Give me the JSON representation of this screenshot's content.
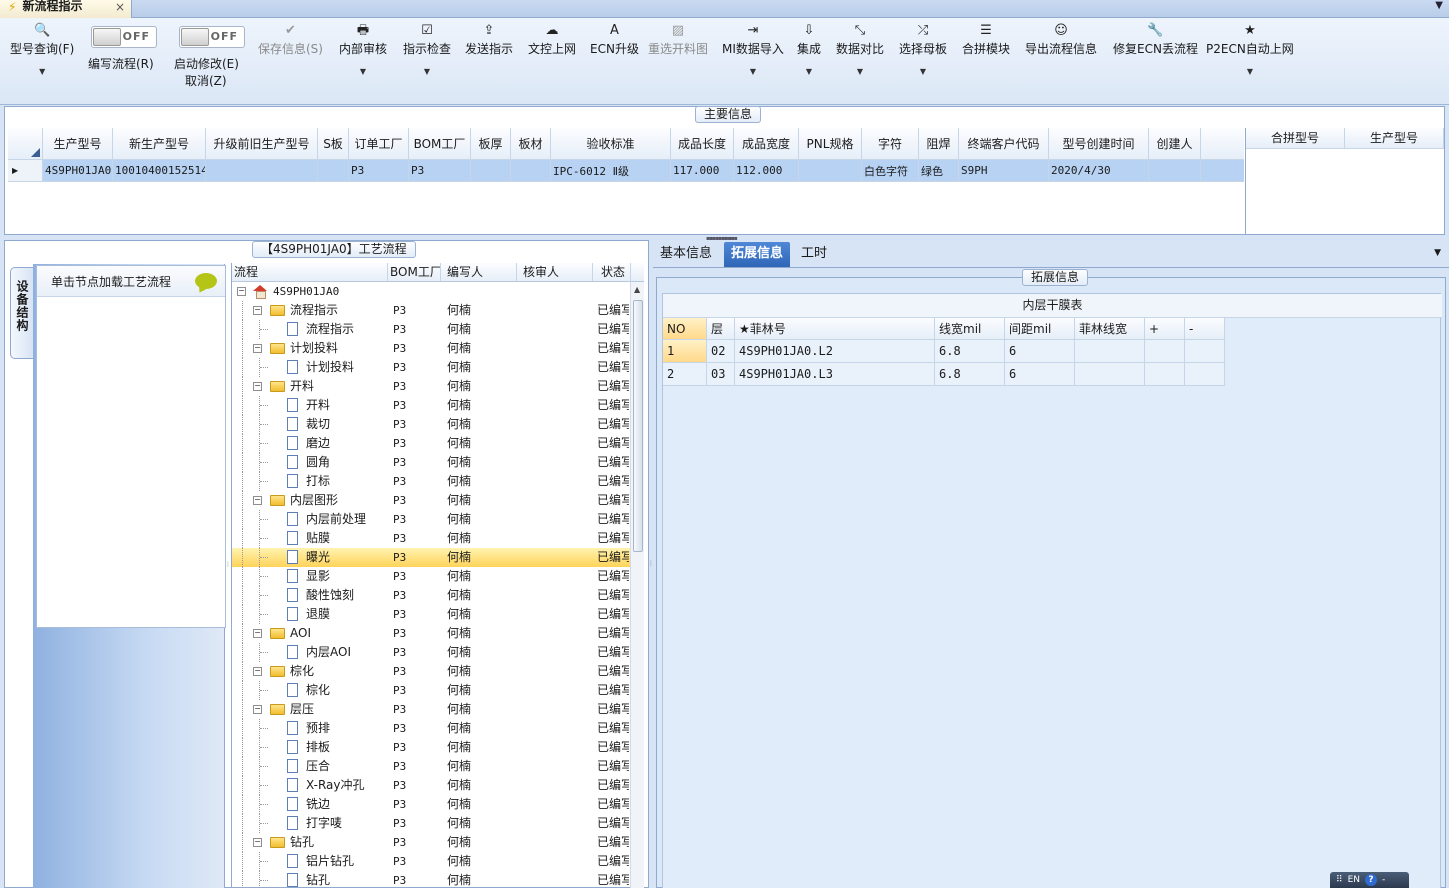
{
  "window": {
    "tab_title": "新流程指示",
    "tab_close": "×"
  },
  "toolbar": {
    "buttons": [
      {
        "label": "型号查询(F)",
        "icon": "search-icon",
        "glyph": "🔍"
      },
      {
        "label": "编写流程(R)"
      },
      {
        "label": "启动修改(E)",
        "sub": "取消(Z)"
      },
      {
        "label": "保存信息(S)",
        "icon": "check-icon",
        "glyph": "✔"
      },
      {
        "label": "内部审核",
        "icon": "printer-icon",
        "glyph": "🖶"
      },
      {
        "label": "指示检查",
        "icon": "checkbox-icon",
        "glyph": "☑"
      },
      {
        "label": "发送指示",
        "icon": "upload-icon",
        "glyph": "⇪"
      },
      {
        "label": "文控上网",
        "icon": "cloud-upload-icon",
        "glyph": "☁"
      },
      {
        "label": "ECN升级",
        "icon": "font-icon",
        "glyph": "A"
      },
      {
        "label": "重选开料图",
        "icon": "image-icon",
        "glyph": "▨"
      },
      {
        "label": "MI数据导入",
        "icon": "sign-in-icon",
        "glyph": "⇥"
      },
      {
        "label": "集成",
        "icon": "download-icon",
        "glyph": "⇩"
      },
      {
        "label": "数据对比",
        "icon": "compress-icon",
        "glyph": "⤡"
      },
      {
        "label": "选择母板",
        "icon": "random-icon",
        "glyph": "⤮"
      },
      {
        "label": "合拼模块",
        "icon": "list-icon",
        "glyph": "☰"
      },
      {
        "label": "导出流程信息",
        "icon": "smile-icon",
        "glyph": "☺"
      },
      {
        "label": "修复ECN丢流程",
        "icon": "wrench-icon",
        "glyph": "🔧"
      },
      {
        "label": "P2ECN自动上网",
        "icon": "star-icon",
        "glyph": "★"
      }
    ],
    "toggle1": "OFF",
    "toggle2": "OFF"
  },
  "main_info": {
    "title": "主要信息",
    "columns": [
      "生产型号",
      "新生产型号",
      "升级前旧生产型号",
      "S板",
      "订单工厂",
      "BOM工厂",
      "板厚",
      "板材",
      "验收标准",
      "成品长度",
      "成品宽度",
      "PNL规格",
      "字符",
      "阻焊",
      "终端客户代码",
      "型号创建时间",
      "创建人"
    ],
    "row": [
      "4S9PH01JA0",
      "10010400152514",
      "",
      "",
      "P3",
      "P3",
      "",
      "",
      "IPC-6012 Ⅱ级",
      "117.000",
      "112.000",
      "",
      "白色字符",
      "绿色",
      "S9PH",
      "2020/4/30",
      ""
    ],
    "merge_columns": [
      "合拼型号",
      "生产型号"
    ]
  },
  "process": {
    "title": "【4S9PH01JA0】工艺流程",
    "side_tab": "设备结构",
    "load_button": "单击节点加载工艺流程",
    "columns": [
      "流程",
      "BOM工厂",
      "编写人",
      "核审人",
      "状态"
    ],
    "rows": [
      {
        "name": "4S9PH01JA0",
        "level": 0,
        "type": "root",
        "bom": "",
        "author": "",
        "status": ""
      },
      {
        "name": "流程指示",
        "level": 1,
        "type": "folder",
        "bom": "P3",
        "author": "何楠",
        "status": "已编写"
      },
      {
        "name": "流程指示",
        "level": 2,
        "type": "doc",
        "bom": "P3",
        "author": "何楠",
        "status": "已编写"
      },
      {
        "name": "计划投料",
        "level": 1,
        "type": "folder",
        "bom": "P3",
        "author": "何楠",
        "status": "已编写"
      },
      {
        "name": "计划投料",
        "level": 2,
        "type": "doc",
        "bom": "P3",
        "author": "何楠",
        "status": "已编写"
      },
      {
        "name": "开料",
        "level": 1,
        "type": "folder",
        "bom": "P3",
        "author": "何楠",
        "status": "已编写"
      },
      {
        "name": "开料",
        "level": 2,
        "type": "doc",
        "bom": "P3",
        "author": "何楠",
        "status": "已编写"
      },
      {
        "name": "裁切",
        "level": 2,
        "type": "doc",
        "bom": "P3",
        "author": "何楠",
        "status": "已编写"
      },
      {
        "name": "磨边",
        "level": 2,
        "type": "doc",
        "bom": "P3",
        "author": "何楠",
        "status": "已编写"
      },
      {
        "name": "圆角",
        "level": 2,
        "type": "doc",
        "bom": "P3",
        "author": "何楠",
        "status": "已编写"
      },
      {
        "name": "打标",
        "level": 2,
        "type": "doc",
        "bom": "P3",
        "author": "何楠",
        "status": "已编写"
      },
      {
        "name": "内层图形",
        "level": 1,
        "type": "folder",
        "bom": "P3",
        "author": "何楠",
        "status": "已编写"
      },
      {
        "name": "内层前处理",
        "level": 2,
        "type": "doc",
        "bom": "P3",
        "author": "何楠",
        "status": "已编写"
      },
      {
        "name": "贴膜",
        "level": 2,
        "type": "doc",
        "bom": "P3",
        "author": "何楠",
        "status": "已编写"
      },
      {
        "name": "曝光",
        "level": 2,
        "type": "doc",
        "bom": "P3",
        "author": "何楠",
        "status": "已编写",
        "selected": true
      },
      {
        "name": "显影",
        "level": 2,
        "type": "doc",
        "bom": "P3",
        "author": "何楠",
        "status": "已编写"
      },
      {
        "name": "酸性蚀刻",
        "level": 2,
        "type": "doc",
        "bom": "P3",
        "author": "何楠",
        "status": "已编写"
      },
      {
        "name": "退膜",
        "level": 2,
        "type": "doc",
        "bom": "P3",
        "author": "何楠",
        "status": "已编写"
      },
      {
        "name": "AOI",
        "level": 1,
        "type": "folder",
        "bom": "P3",
        "author": "何楠",
        "status": "已编写"
      },
      {
        "name": "内层AOI",
        "level": 2,
        "type": "doc",
        "bom": "P3",
        "author": "何楠",
        "status": "已编写"
      },
      {
        "name": "棕化",
        "level": 1,
        "type": "folder",
        "bom": "P3",
        "author": "何楠",
        "status": "已编写"
      },
      {
        "name": "棕化",
        "level": 2,
        "type": "doc",
        "bom": "P3",
        "author": "何楠",
        "status": "已编写"
      },
      {
        "name": "层压",
        "level": 1,
        "type": "folder",
        "bom": "P3",
        "author": "何楠",
        "status": "已编写"
      },
      {
        "name": "预排",
        "level": 2,
        "type": "doc",
        "bom": "P3",
        "author": "何楠",
        "status": "已编写"
      },
      {
        "name": "排板",
        "level": 2,
        "type": "doc",
        "bom": "P3",
        "author": "何楠",
        "status": "已编写"
      },
      {
        "name": "压合",
        "level": 2,
        "type": "doc",
        "bom": "P3",
        "author": "何楠",
        "status": "已编写"
      },
      {
        "name": "X-Ray冲孔",
        "level": 2,
        "type": "doc",
        "bom": "P3",
        "author": "何楠",
        "status": "已编写"
      },
      {
        "name": "铣边",
        "level": 2,
        "type": "doc",
        "bom": "P3",
        "author": "何楠",
        "status": "已编写"
      },
      {
        "name": "打字唛",
        "level": 2,
        "type": "doc",
        "bom": "P3",
        "author": "何楠",
        "status": "已编写"
      },
      {
        "name": "钻孔",
        "level": 1,
        "type": "folder",
        "bom": "P3",
        "author": "何楠",
        "status": "已编写"
      },
      {
        "name": "铝片钻孔",
        "level": 2,
        "type": "doc",
        "bom": "P3",
        "author": "何楠",
        "status": "已编写"
      },
      {
        "name": "钻孔",
        "level": 2,
        "type": "doc",
        "bom": "P3",
        "author": "何楠",
        "status": "已编写"
      }
    ]
  },
  "right": {
    "tabs": [
      "基本信息",
      "拓展信息",
      "工时"
    ],
    "active_tab": 1,
    "panel_title": "拓展信息",
    "film_title": "内层干膜表",
    "film_columns": [
      "NO",
      "层",
      "★菲林号",
      "线宽mil",
      "间距mil",
      "菲林线宽",
      "+",
      "-"
    ],
    "film_rows": [
      [
        "1",
        "02",
        "4S9PH01JA0.L2",
        "6.8",
        "6",
        "",
        "",
        ""
      ],
      [
        "2",
        "03",
        "4S9PH01JA0.L3",
        "6.8",
        "6",
        "",
        "",
        ""
      ]
    ]
  },
  "status": {
    "lang": "EN",
    "help": "?",
    "dash": "-"
  }
}
